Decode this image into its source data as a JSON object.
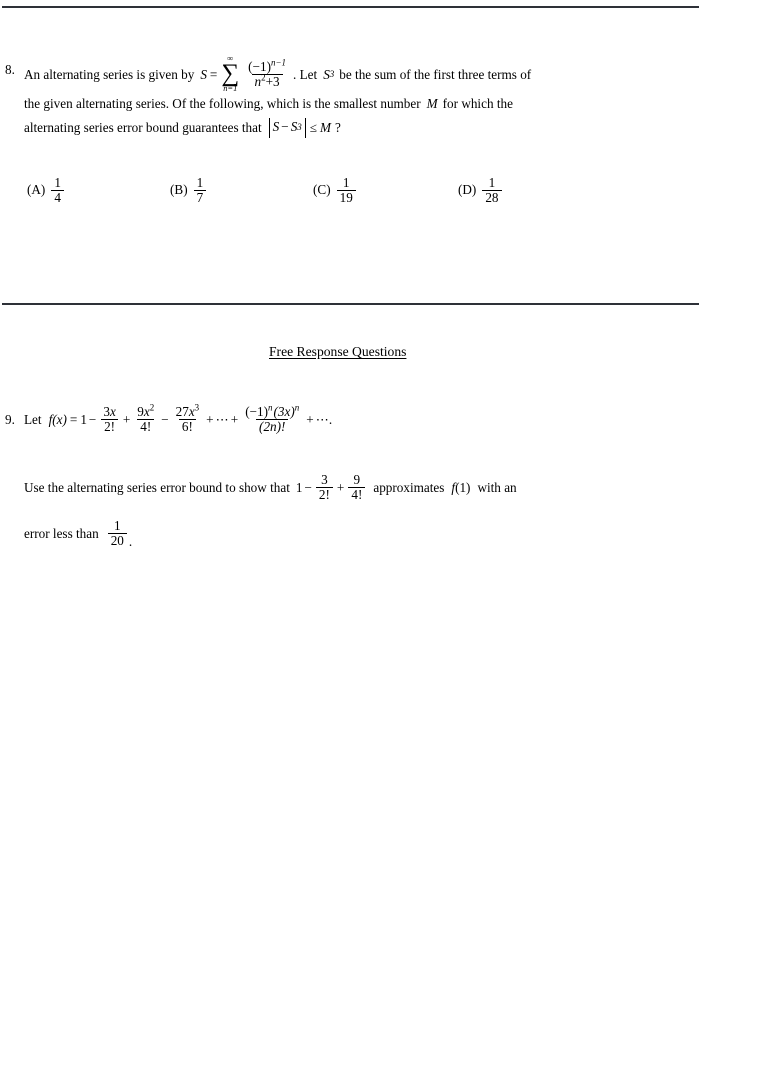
{
  "document": {
    "type": "math-worksheet-page",
    "background_color": "#ffffff",
    "rule_color": "#2e3138"
  },
  "question8": {
    "number": "8.",
    "line1_part1": "An alternating series is given by",
    "formula": {
      "S": "S",
      "equals": "=",
      "sigma": "∑",
      "sum_upper": "∞",
      "sum_lower": "n=1",
      "numerator": "(−1)",
      "numerator_exponent": "n−1",
      "denominator_base": "n",
      "denominator_exponent": "2",
      "denominator_rest": "+3"
    },
    "line1_part2": ". Let",
    "S3_base": "S",
    "S3_sub": "3",
    "line1_part3": "be the sum of the first three terms of",
    "line2": "the given alternating series. Of the following, which is the smallest number",
    "line2_var": "M",
    "line2_end": "for which the",
    "line3_part1": "alternating series error bound guarantees that",
    "abs_expr": {
      "S": "S",
      "minus": "−",
      "S3": "S",
      "S3_sub": "3"
    },
    "line3_relation": "≤",
    "line3_var": "M",
    "line3_end": "?",
    "choices": [
      {
        "label": "(A)",
        "numerator": "1",
        "denominator": "4"
      },
      {
        "label": "(B)",
        "numerator": "1",
        "denominator": "7"
      },
      {
        "label": "(C)",
        "numerator": "1",
        "denominator": "19"
      },
      {
        "label": "(D)",
        "numerator": "1",
        "denominator": "28"
      }
    ]
  },
  "section_header": {
    "title": "Free Response Questions"
  },
  "question9": {
    "number": "9.",
    "lead": "Let",
    "fx": "f",
    "fx_arg": "(x)",
    "equals": "=",
    "one": "1",
    "minus1": "−",
    "t1_num_coeff": "3",
    "t1_num_var": "x",
    "t1_den": "2!",
    "plus1": "+",
    "t2_num_coeff": "9",
    "t2_num_var": "x",
    "t2_num_exp": "2",
    "t2_den": "4!",
    "minus2": "−",
    "t3_num_coeff": "27",
    "t3_num_var": "x",
    "t3_num_exp": "3",
    "t3_den": "6!",
    "plus2": "+",
    "dots1": "⋯",
    "plus3": "+",
    "gen_num_sign": "(−1)",
    "gen_num_sign_exp": "n",
    "gen_num_base": "(3x)",
    "gen_num_exp": "n",
    "gen_den": "(2n)!",
    "plus4": "+",
    "dots2": "⋯",
    "period": ".",
    "prompt_part1": "Use the alternating series error bound to show that",
    "approx_one": "1",
    "approx_minus": "−",
    "approx_t1_num": "3",
    "approx_t1_den": "2!",
    "approx_plus": "+",
    "approx_t2_num": "9",
    "approx_t2_den": "4!",
    "prompt_part2": "approximates",
    "prompt_f": "f",
    "prompt_f_arg": "(1)",
    "prompt_part3": "with an",
    "prompt_part4": "error less than",
    "error_num": "1",
    "error_den": "20",
    "error_period": "."
  }
}
